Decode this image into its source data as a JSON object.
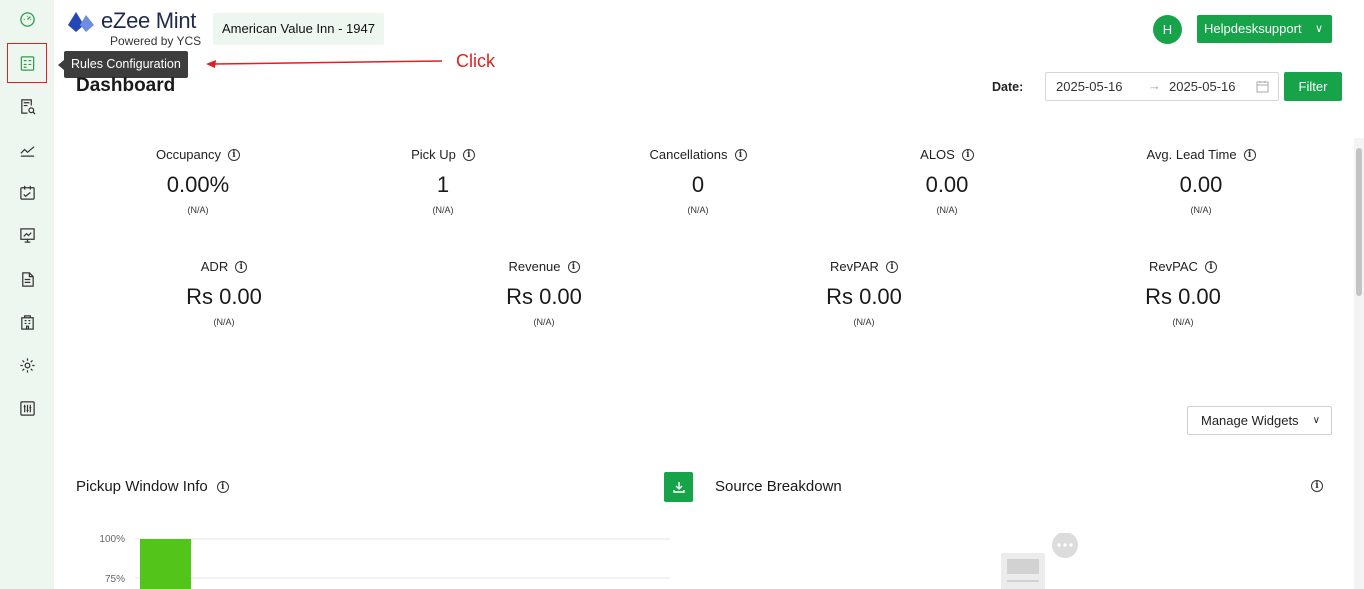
{
  "brand": {
    "name": "eZee Mint",
    "tagline": "Powered by YCS"
  },
  "header": {
    "hotel": "American Value Inn -  1947",
    "avatar_initial": "H",
    "user": "Helpdesksupport"
  },
  "tooltip": "Rules Configuration",
  "annotation": "Click",
  "page": {
    "title": "Dashboard"
  },
  "filter": {
    "date_label": "Date:",
    "start": "2025-05-16",
    "end": "2025-05-16",
    "button": "Filter"
  },
  "kpis": [
    {
      "label": "Occupancy",
      "value": "0.00%",
      "sub": "(N/A)"
    },
    {
      "label": "Pick Up",
      "value": "1",
      "sub": "(N/A)"
    },
    {
      "label": "Cancellations",
      "value": "0",
      "sub": "(N/A)"
    },
    {
      "label": "ALOS",
      "value": "0.00",
      "sub": "(N/A)"
    },
    {
      "label": "Avg. Lead Time",
      "value": "0.00",
      "sub": "(N/A)"
    },
    {
      "label": "ADR",
      "value": "Rs 0.00",
      "sub": "(N/A)"
    },
    {
      "label": "Revenue",
      "value": "Rs 0.00",
      "sub": "(N/A)"
    },
    {
      "label": "RevPAR",
      "value": "Rs 0.00",
      "sub": "(N/A)"
    },
    {
      "label": "RevPAC",
      "value": "Rs 0.00",
      "sub": "(N/A)"
    }
  ],
  "widgets": {
    "manage_label": "Manage Widgets"
  },
  "sections": {
    "pickup": "Pickup Window Info",
    "source": "Source Breakdown"
  },
  "pickup_chart": {
    "ticks": [
      "100%",
      "75%"
    ],
    "bar_value": 1.0,
    "bar_color": "#52c41a"
  },
  "colors": {
    "accent": "#16a34a",
    "sidebar_bg": "#eef7ef",
    "highlight": "#e02020"
  }
}
